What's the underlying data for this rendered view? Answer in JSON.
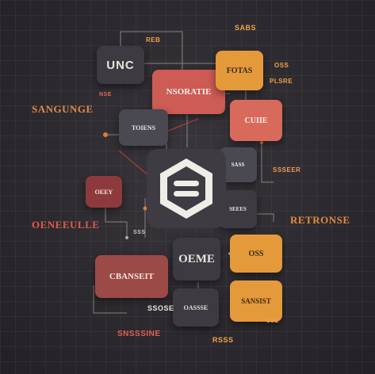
{
  "nodes": {
    "unc": "UNC",
    "nsoratie": "NSORATIE",
    "fotas": "FOTAS",
    "cuiie": "CUIIE",
    "toiens": "TOIENS",
    "oeey": "OEEY",
    "sass": "SASS",
    "seees": "SEEES",
    "oeme": "OEME",
    "oss": "OSS",
    "cbanseit": "CBANSEIT",
    "oassse": "OASSSE",
    "sansist": "SANSIST"
  },
  "tags": {
    "sangunge": "SANGUNGE",
    "oeneeulle": "OENEEULLE",
    "retroonse": "RETRONSE",
    "top_center": "REB",
    "top_right": "SABS",
    "bottom_center": "SNSSSINE",
    "bottom_right": "RSSS",
    "right_mid": "SSSEER",
    "left_small_1": "NSE",
    "left_small_2": "SSS",
    "mid_small": "SSOSE",
    "small_right_1": "SSE",
    "small_right_2": "PLSRE",
    "small_top": "OSS"
  },
  "center_icon": "hexagon-database-icon"
}
